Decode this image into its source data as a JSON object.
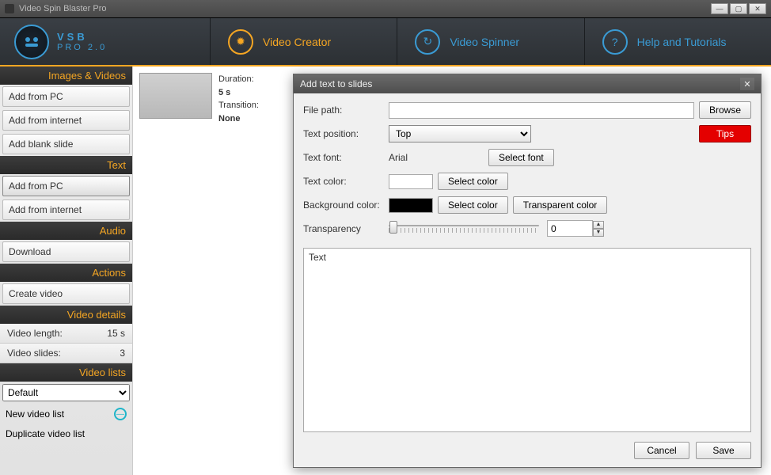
{
  "window": {
    "title": "Video Spin Blaster Pro"
  },
  "logo": {
    "line1": "VSB",
    "line2": "PRO 2.0"
  },
  "nav": {
    "creator": "Video Creator",
    "spinner": "Video Spinner",
    "help": "Help and Tutorials"
  },
  "sidebar": {
    "sections": {
      "images": "Images & Videos",
      "text": "Text",
      "audio": "Audio",
      "actions": "Actions",
      "details": "Video details",
      "lists": "Video lists"
    },
    "images_items": {
      "pc": "Add from PC",
      "net": "Add from internet",
      "blank": "Add blank slide"
    },
    "text_items": {
      "pc": "Add from PC",
      "net": "Add from internet"
    },
    "audio_items": {
      "download": "Download"
    },
    "actions_items": {
      "create": "Create video"
    },
    "details": {
      "length_label": "Video length:",
      "length_val": "15 s",
      "slides_label": "Video slides:",
      "slides_val": "3"
    },
    "lists": {
      "selected": "Default",
      "new": "New video list",
      "dup": "Duplicate video list"
    }
  },
  "slide": {
    "duration_label": "Duration:",
    "duration_val": "5 s",
    "transition_label": "Transition:",
    "transition_val": "None"
  },
  "dialog": {
    "title": "Add text to slides",
    "filepath_label": "File path:",
    "filepath_val": "",
    "browse": "Browse",
    "position_label": "Text position:",
    "position_val": "Top",
    "tips": "Tips",
    "font_label": "Text font:",
    "font_val": "Arial",
    "select_font": "Select font",
    "textcolor_label": "Text color:",
    "select_color": "Select color",
    "bgcolor_label": "Background color:",
    "transparent": "Transparent color",
    "transparency_label": "Transparency",
    "transparency_val": "0",
    "text_box_label": "Text",
    "cancel": "Cancel",
    "save": "Save"
  }
}
